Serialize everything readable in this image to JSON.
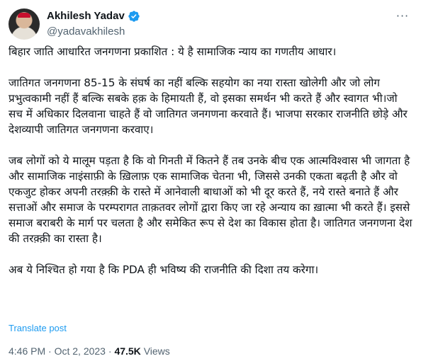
{
  "author": {
    "display_name": "Akhilesh Yadav",
    "handle": "@yadavakhilesh",
    "verified_color": "#1d9bf0"
  },
  "more_label": "···",
  "post": {
    "paragraphs": [
      "बिहार जाति आधारित जनगणना प्रकाशित : ये है सामाजिक न्याय का गणतीय आधार।",
      "जातिगत जनगणना 85-15 के संघर्ष का नहीं बल्कि सहयोग का नया रास्ता खोलेगी और जो लोग प्रभुत्वकामी नहीं हैं बल्कि सबके हक़ के हिमायती हैं, वो इसका समर्थन भी करते हैं और स्वागत भी।जो सच में अधिकार दिलवाना चाहते हैं वो जातिगत जनगणना करवाते हैं। भाजपा सरकार राजनीति छोड़े और देशव्यापी जातिगत जनगणना करवाए।",
      "जब लोगों को ये मालूम पड़ता है कि वो गिनती में कितने हैं तब उनके बीच एक आत्मविश्वास भी जागता है और सामाजिक नाइंसाफ़ी के ख़िलाफ़ एक सामाजिक चेतना भी, जिससे उनकी एकता बढ़ती है और वो एकजुट होकर अपनी तरक़्क़ी के रास्ते में आनेवाली बाधाओं को भी दूर करते हैं, नये रास्ते बनाते हैं और सत्ताओं और समाज के परम्परागत ताक़तवर लोगों द्वारा किए जा रहे अन्याय का ख़ात्मा भी करते हैं। इससे समाज बराबरी के मार्ग पर चलता है और समेकित रूप से देश का विकास होता है। जातिगत जनगणना देश की तरक़्क़ी का रास्ता है।",
      "अब ये निश्चित हो गया है कि PDA ही भविष्य की राजनीति की दिशा तय करेगा।"
    ],
    "translate_label": "Translate post",
    "time": "4:46 PM",
    "separator": "·",
    "date": "Oct 2, 2023",
    "views_count": "47.5K",
    "views_label": "Views"
  },
  "colors": {
    "link": "#1d9bf0",
    "muted": "#536471",
    "text": "#0f1419"
  }
}
